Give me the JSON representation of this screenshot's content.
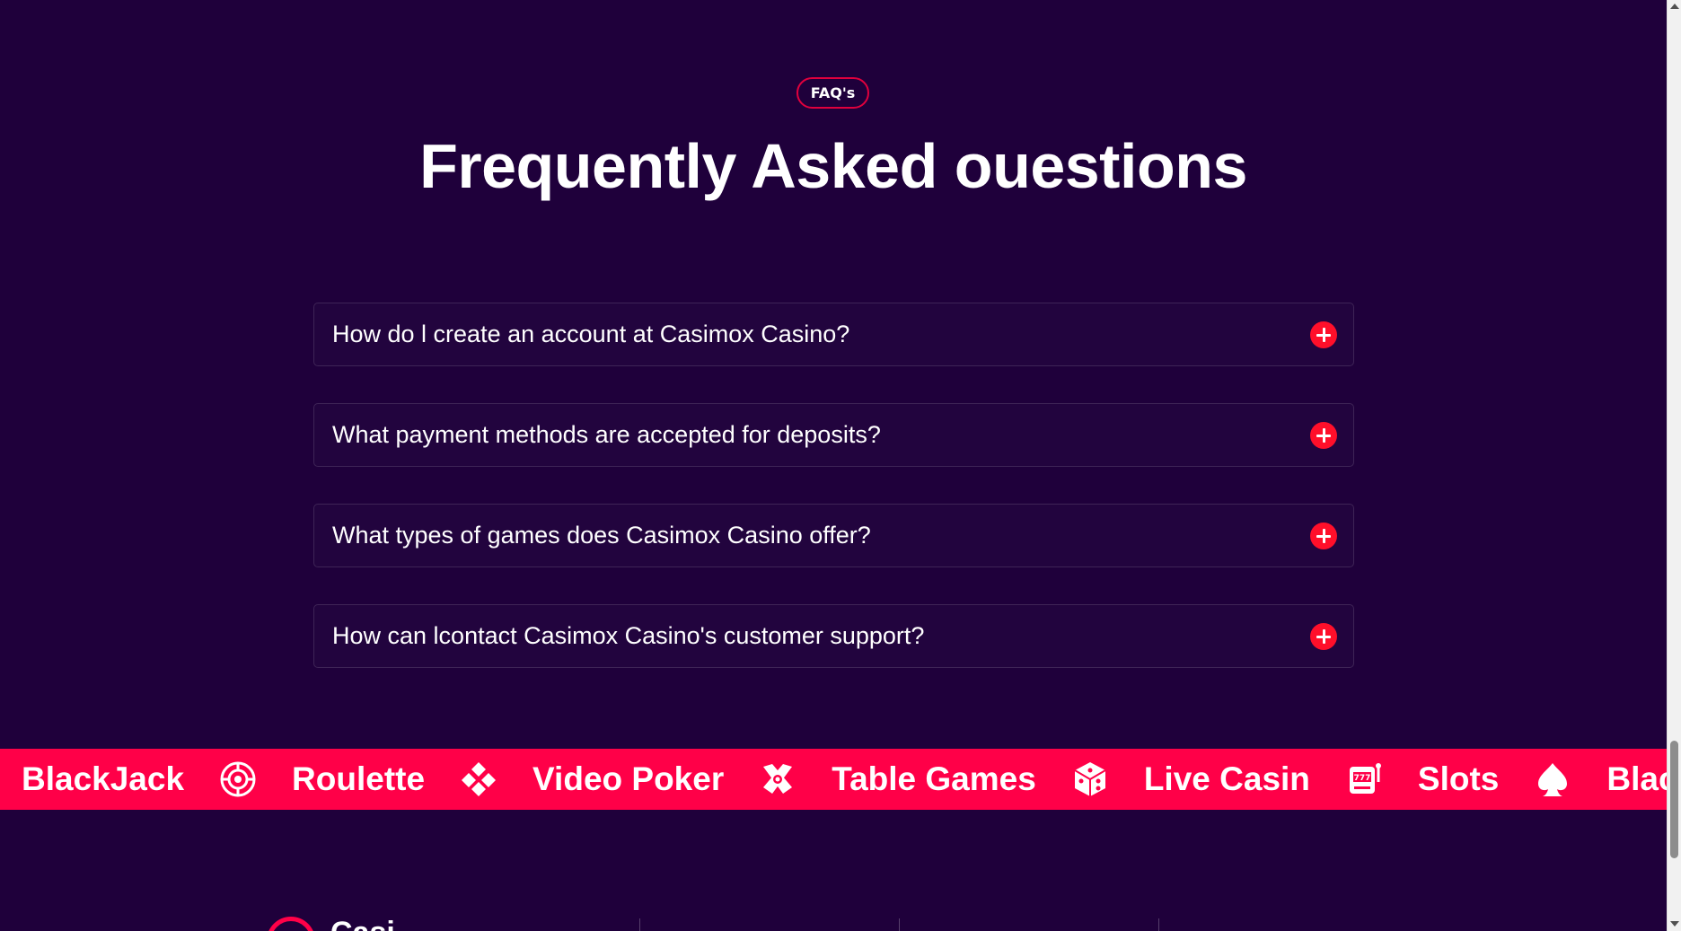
{
  "faq": {
    "badge": "FAQ's",
    "title": "Frequently Asked ouestions",
    "items": [
      {
        "question": "How do l create an account at Casimox Casino?",
        "toggle_icon": "plus-icon"
      },
      {
        "question": "What payment methods are accepted for deposits?",
        "toggle_icon": "plus-icon"
      },
      {
        "question": "What types of games does Casimox Casino offer?",
        "toggle_icon": "plus-icon"
      },
      {
        "question": "How can lcontact Casimox Casino's customer support?",
        "toggle_icon": "plus-icon"
      }
    ]
  },
  "marquee": {
    "items": [
      {
        "label": "BlackJack",
        "icon": "roulette-wheel-icon"
      },
      {
        "label": "Roulette",
        "icon": "cards-suit-cluster-icon"
      },
      {
        "label": "Video Poker",
        "icon": "casino-chip-cards-icon"
      },
      {
        "label": "Table Games",
        "icon": "dice-icon"
      },
      {
        "label": "Live Casin",
        "icon": "slot-machine-icon"
      },
      {
        "label": "Slots",
        "icon": "spade-icon"
      },
      {
        "label": "BlackJ",
        "icon": ""
      }
    ]
  },
  "footer": {
    "logo_text": "Casi"
  },
  "colors": {
    "background": "#1f003b",
    "accent": "#ff0048",
    "badge_border": "#e0003d",
    "toggle_button": "#ff0f2a",
    "text": "#ffffff"
  }
}
